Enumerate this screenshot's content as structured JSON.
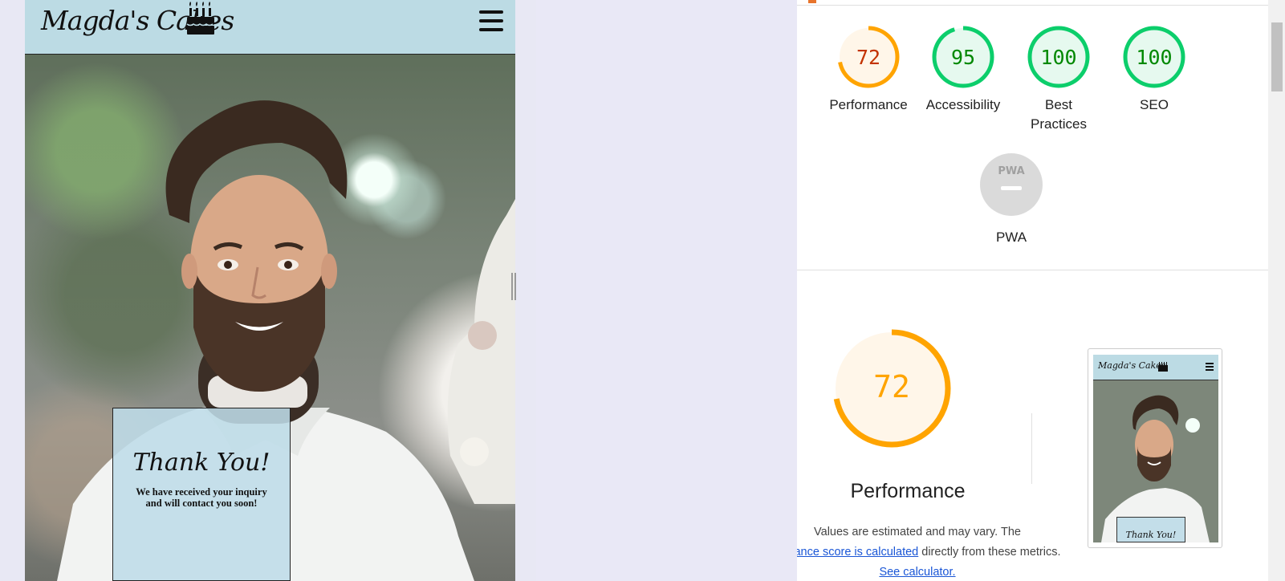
{
  "site": {
    "logo_text": "Magda's Cakes",
    "thank_you_title": "Thank You!",
    "thank_you_message": "We have received your inquiry and will contact you soon!"
  },
  "colors": {
    "header_bg": "#bcdbe4",
    "score_average": "#ffa400",
    "score_good": "#0cce6b",
    "score_average_text": "#c33300",
    "score_good_text": "#008800",
    "pwa_gray": "#dadada"
  },
  "lighthouse": {
    "categories": [
      {
        "label": "Performance",
        "score": "72",
        "fraction": 0.72,
        "status": "average"
      },
      {
        "label": "Accessibility",
        "score": "95",
        "fraction": 0.95,
        "status": "good"
      },
      {
        "label": "Best Practices",
        "score": "100",
        "fraction": 1.0,
        "status": "good"
      },
      {
        "label": "SEO",
        "score": "100",
        "fraction": 1.0,
        "status": "good"
      }
    ],
    "pwa": {
      "label": "PWA",
      "badge_text": "PWA"
    },
    "performance_detail": {
      "score": "72",
      "fraction": 0.72,
      "title": "Performance",
      "desc_part1": "Values are estimated and may vary. The ",
      "desc_link1": "ormance score is calculated",
      "desc_part2": " directly from these metrics. ",
      "desc_link2": "See calculator."
    },
    "thumbnail": {
      "logo_text": "Magda's Cakes",
      "card_text": "Thank You!"
    }
  }
}
